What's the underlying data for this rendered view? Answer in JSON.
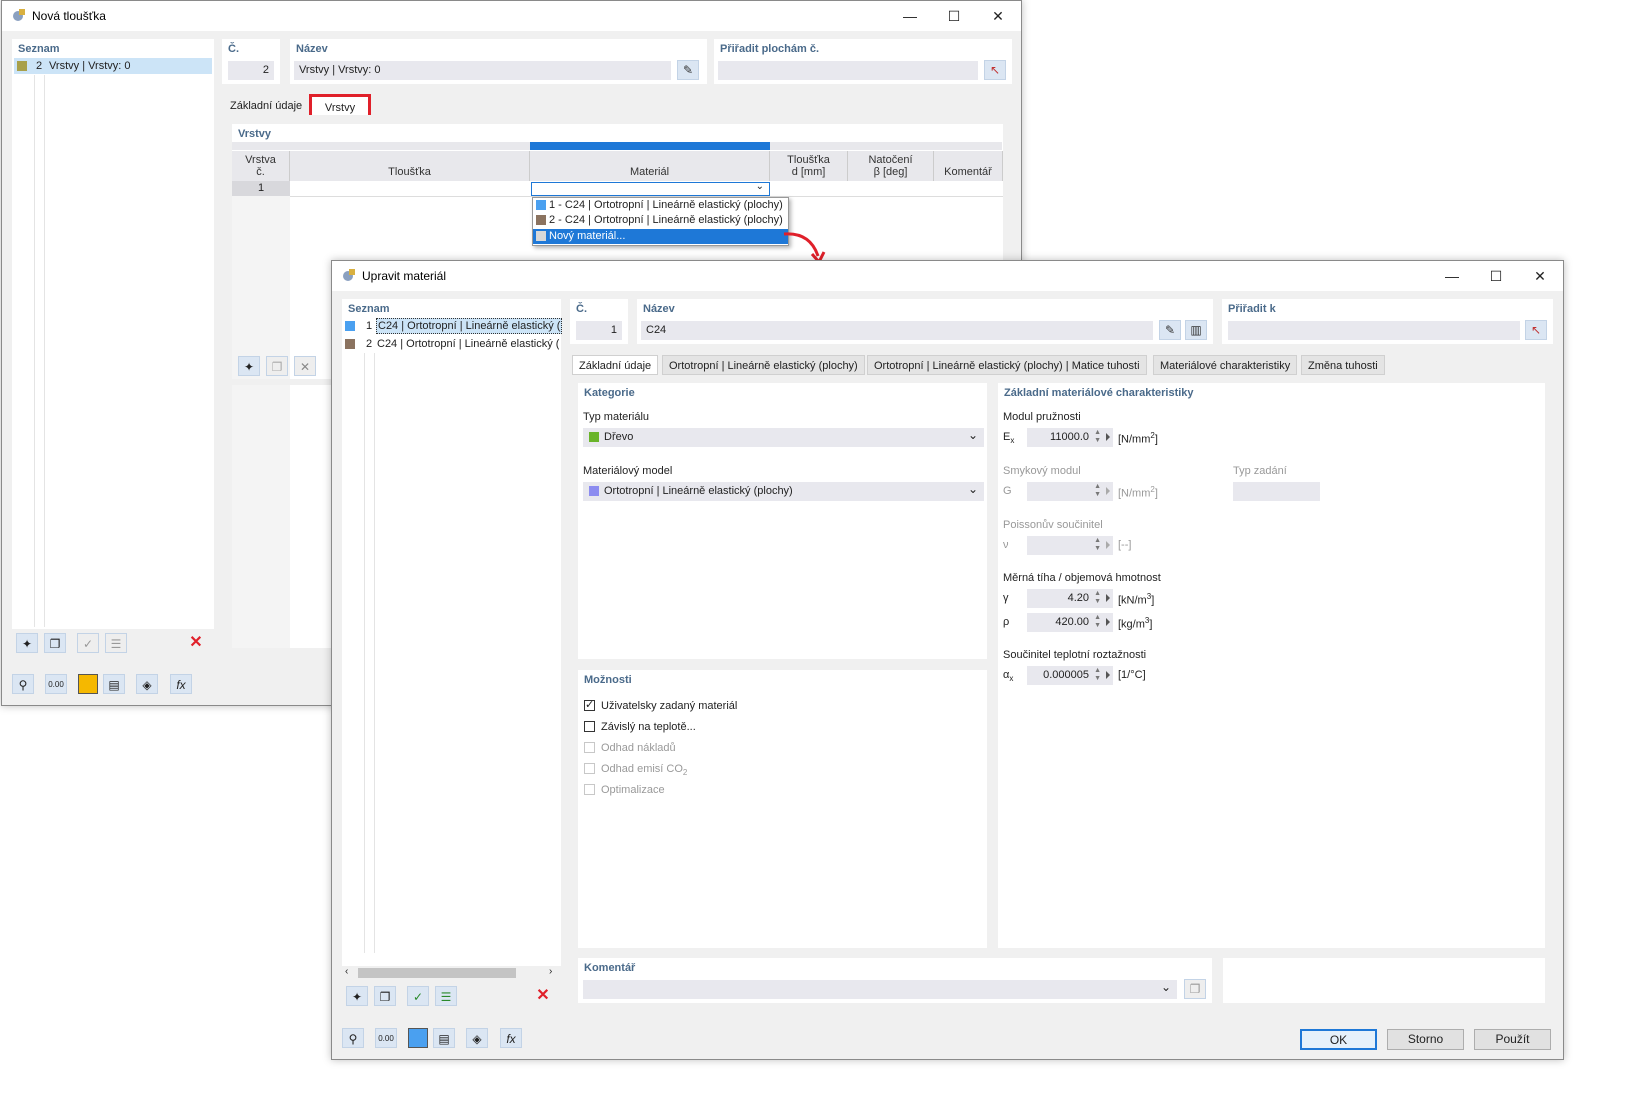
{
  "win1": {
    "title": "Nová tloušťka",
    "list_header": "Seznam",
    "list_items": [
      {
        "num": "2",
        "label": "Vrstvy | Vrstvy: 0",
        "color": "#a8a04a"
      }
    ],
    "no_header": "Č.",
    "no_value": "2",
    "name_header": "Název",
    "name_value": "Vrstvy | Vrstvy: 0",
    "assign_header": "Přiřadit plochám č.",
    "tabs": [
      "Základní údaje",
      "Vrstvy"
    ],
    "section_header": "Vrstvy",
    "columns": {
      "layer_no_1": "Vrstva",
      "layer_no_2": "č.",
      "thickness": "Tloušťka",
      "material": "Materiál",
      "thick_d_1": "Tloušťka",
      "thick_d_2": "d [mm]",
      "rotation_1": "Natočení",
      "rotation_2": "β [deg]",
      "comment": "Komentář"
    },
    "row_number": "1",
    "dropdown": [
      {
        "label": "1 - C24 | Ortotropní | Lineárně elastický (plochy)",
        "color": "#4aa0f0"
      },
      {
        "label": "2 - C24 | Ortotropní | Lineárně elastický (plochy)",
        "color": "#8b7360"
      },
      {
        "label": "Nový materiál...",
        "color": "#d8d8d8"
      }
    ]
  },
  "win2": {
    "title": "Upravit materiál",
    "list_header": "Seznam",
    "list_items": [
      {
        "num": "1",
        "label": "C24 | Ortotropní | Lineárně elastický (",
        "color": "#4aa0f0"
      },
      {
        "num": "2",
        "label": "C24 | Ortotropní | Lineárně elastický (",
        "color": "#8b7360"
      }
    ],
    "no_header": "Č.",
    "no_value": "1",
    "name_header": "Název",
    "name_value": "C24",
    "assign_header": "Přiřadit k",
    "tabs": [
      "Základní údaje",
      "Ortotropní | Lineárně elastický (plochy)",
      "Ortotropní | Lineárně elastický (plochy) | Matice tuhosti",
      "Materiálové charakteristiky",
      "Změna tuhosti"
    ],
    "category": {
      "header": "Kategorie",
      "type_label": "Typ materiálu",
      "type_value": "Dřevo",
      "type_color": "#6ab42a",
      "model_label": "Materiálový model",
      "model_value": "Ortotropní | Lineárně elastický (plochy)",
      "model_color": "#8c8cf0"
    },
    "options": {
      "header": "Možnosti",
      "items": [
        {
          "label": "Uživatelsky zadaný materiál",
          "checked": "true",
          "enabled": "true"
        },
        {
          "label": "Závislý na teplotě...",
          "checked": "false",
          "enabled": "true"
        },
        {
          "label": "Odhad nákladů",
          "checked": "false",
          "enabled": "false"
        },
        {
          "label": "Odhad emisí CO",
          "sub": "2",
          "checked": "false",
          "enabled": "false"
        },
        {
          "label": "Optimalizace",
          "checked": "false",
          "enabled": "false"
        }
      ]
    },
    "props": {
      "header": "Základní materiálové charakteristiky",
      "elastic_label": "Modul pružnosti",
      "ex_sym": "E",
      "ex_sub": "x",
      "ex_value": "11000.0",
      "ex_unit": "[N/mm",
      "ex_unit_sup": "2",
      "shear_label": "Smykový modul",
      "g_sym": "G",
      "g_unit": "[N/mm",
      "g_unit_sup": "2",
      "input_type_label": "Typ zadání",
      "poisson_label": "Poissonův součinitel",
      "nu_sym": "ν",
      "nu_unit": "[--]",
      "weight_label": "Měrná tíha / objemová hmotnost",
      "gamma_sym": "γ",
      "gamma_value": "4.20",
      "gamma_unit": "[kN/m",
      "gamma_unit_sup": "3",
      "rho_sym": "ρ",
      "rho_value": "420.00",
      "rho_unit": "[kg/m",
      "rho_unit_sup": "3",
      "thermal_label": "Součinitel teplotní roztažnosti",
      "alpha_sym": "α",
      "alpha_sub": "x",
      "alpha_value": "0.000005",
      "alpha_unit": "[1/°C]"
    },
    "comment_header": "Komentář",
    "buttons": {
      "ok": "OK",
      "cancel": "Storno",
      "apply": "Použít"
    }
  },
  "colors": {
    "accent": "#1e78d7",
    "highlight": "#e0202a",
    "selection": "#cce4f7",
    "header_text": "#4a6a8a"
  }
}
